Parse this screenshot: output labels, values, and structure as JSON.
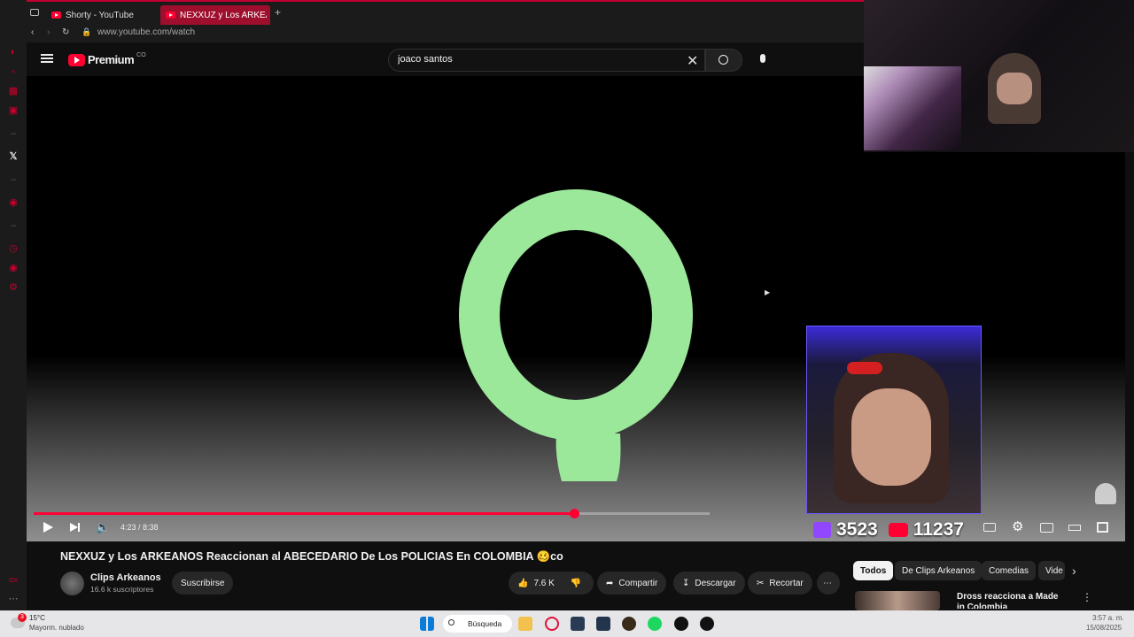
{
  "browser": {
    "tabs": [
      {
        "label": "Shorty - YouTube"
      },
      {
        "label": "NEXXUZ y Los ARKEANO"
      }
    ],
    "url": "www.youtube.com/watch"
  },
  "header": {
    "brand": "Premium",
    "country": "CO",
    "search_value": "joaco santos"
  },
  "player": {
    "time": "4:23 / 8:38",
    "progress_fraction": 0.8,
    "letter": "Q",
    "letter_color": "#9be89b"
  },
  "stream_stats": {
    "twitch_viewers": "3523",
    "youtube_viewers": "11237"
  },
  "video": {
    "title": "NEXXUZ y Los ARKEANOS Reaccionan al ABECEDARIO De Los POLICIAS En COLOMBIA 🥴co",
    "channel": "Clips Arkeanos",
    "subscribers": "16.6 k suscriptores",
    "subscribe_label": "Suscribirse",
    "likes": "7.6 K",
    "share_label": "Compartir",
    "download_label": "Descargar",
    "clip_label": "Recortar",
    "more_label": "⋯"
  },
  "chips": [
    "Todos",
    "De Clips Arkeanos",
    "Comedias",
    "Vide"
  ],
  "recommended": {
    "title": "Dross reacciona a Made in Colombia"
  },
  "taskbar": {
    "weather_temp": "15°C",
    "weather_desc": "Mayorm. nublado",
    "search_label": "Búsqueda",
    "time": "3:57 a. m.",
    "date": "15/08/2025",
    "badge": "3"
  },
  "colors": {
    "accent": "#ff0033",
    "opera_red": "#c8002d"
  }
}
